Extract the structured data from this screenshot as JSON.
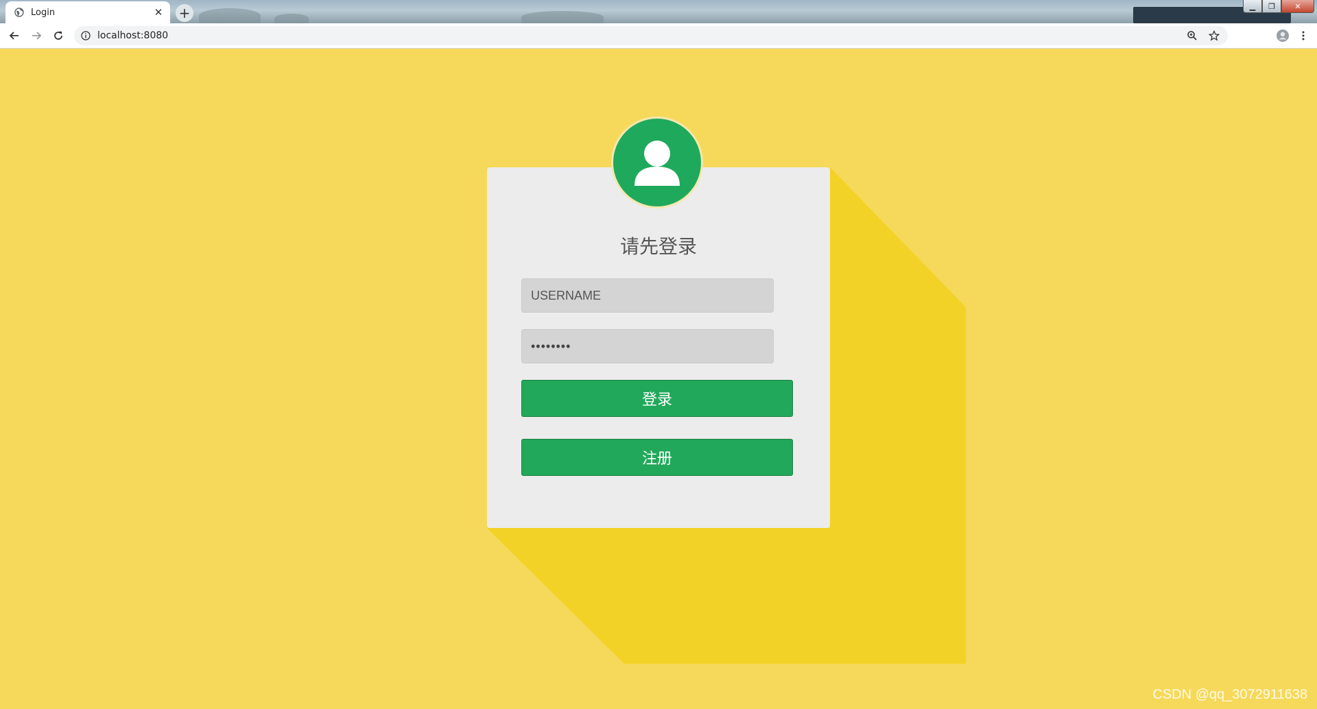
{
  "browser": {
    "tab_title": "Login",
    "address": "localhost:8080"
  },
  "page": {
    "title": "请先登录",
    "username_placeholder": "USERNAME",
    "password_value": "password",
    "login_button": "登录",
    "register_button": "注册"
  },
  "watermark": "CSDN @qq_3072911638",
  "colors": {
    "background": "#f6d95a",
    "long_shadow": "#f2d226",
    "card": "#ececec",
    "accent_green": "#22a85a",
    "avatar_green": "#1fa95c"
  }
}
